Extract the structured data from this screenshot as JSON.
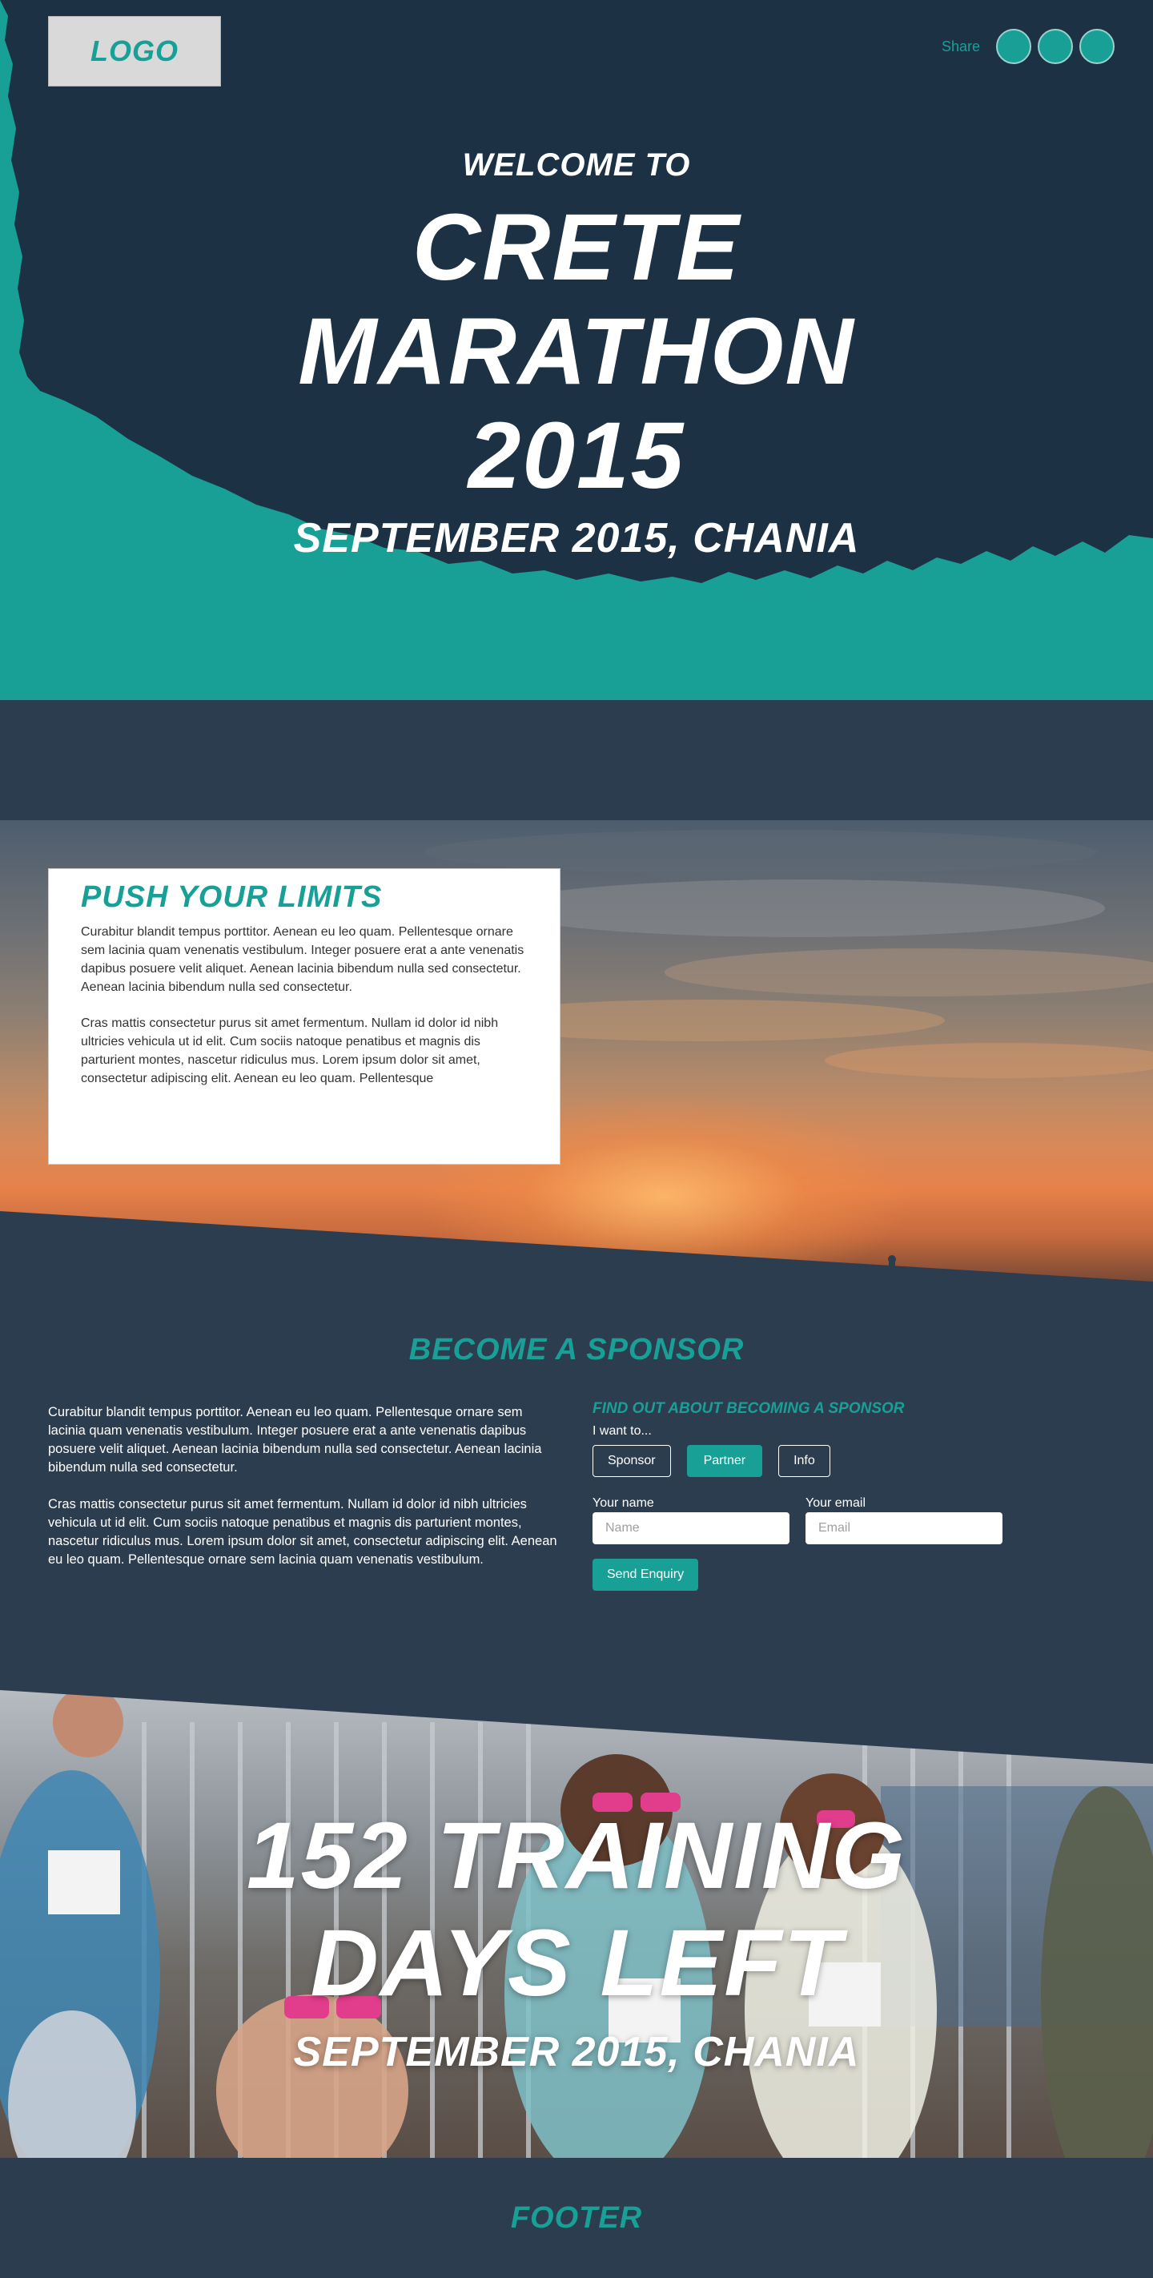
{
  "header": {
    "logo": "LOGO",
    "share_label": "Share",
    "share_buttons": [
      "share-button-1",
      "share-button-2",
      "share-button-3"
    ]
  },
  "hero": {
    "welcome": "WELCOME TO",
    "title_line1": "CRETE",
    "title_line2": "MARATHON",
    "title_line3": "2015",
    "date": "SEPTEMBER 2015, CHANIA"
  },
  "intro": {
    "title": "PUSH YOUR LIMITS",
    "paragraph1": "Curabitur blandit tempus porttitor. Aenean eu leo quam. Pellentesque ornare sem lacinia quam venenatis vestibulum. Integer posuere erat a ante venenatis dapibus posuere velit aliquet. Aenean lacinia bibendum nulla sed consectetur. Aenean lacinia bibendum nulla sed consectetur.",
    "paragraph2": "Cras mattis consectetur purus sit amet fermentum. Nullam id dolor id nibh ultricies vehicula ut id elit. Cum sociis natoque penatibus et magnis dis parturient montes, nascetur ridiculus mus. Lorem ipsum dolor sit amet, consectetur adipiscing elit. Aenean eu leo quam. Pellentesque"
  },
  "sponsor": {
    "title": "BECOME A SPONSOR",
    "paragraph1": "Curabitur blandit tempus porttitor. Aenean eu leo quam. Pellentesque ornare sem lacinia quam venenatis vestibulum. Integer posuere erat a ante venenatis dapibus posuere velit aliquet. Aenean lacinia bibendum nulla sed consectetur. Aenean lacinia bibendum nulla sed consectetur.",
    "paragraph2": "Cras mattis consectetur purus sit amet fermentum. Nullam id dolor id nibh ultricies vehicula ut id elit. Cum sociis natoque penatibus et magnis dis parturient montes, nascetur ridiculus mus. Lorem ipsum dolor sit amet, consectetur adipiscing elit. Aenean eu leo quam. Pellentesque ornare sem lacinia quam venenatis vestibulum.",
    "form": {
      "heading": "FIND OUT ABOUT BECOMING A SPONSOR",
      "want_label": "I want to...",
      "options": [
        "Sponsor",
        "Partner",
        "Info"
      ],
      "selected_option": "Partner",
      "name_label": "Your name",
      "name_placeholder": "Name",
      "name_value": "",
      "email_label": "Your email",
      "email_placeholder": "Email",
      "email_value": "",
      "submit_label": "Send Enquiry"
    }
  },
  "countdown": {
    "line1": "152 TRAINING",
    "line2": "DAYS LEFT",
    "date": "SEPTEMBER 2015, CHANIA"
  },
  "footer": {
    "label": "FOOTER"
  },
  "colors": {
    "accent": "#18a097",
    "hero_dark": "#1c3144",
    "page_bg": "#2d3d50",
    "white": "#ffffff"
  }
}
